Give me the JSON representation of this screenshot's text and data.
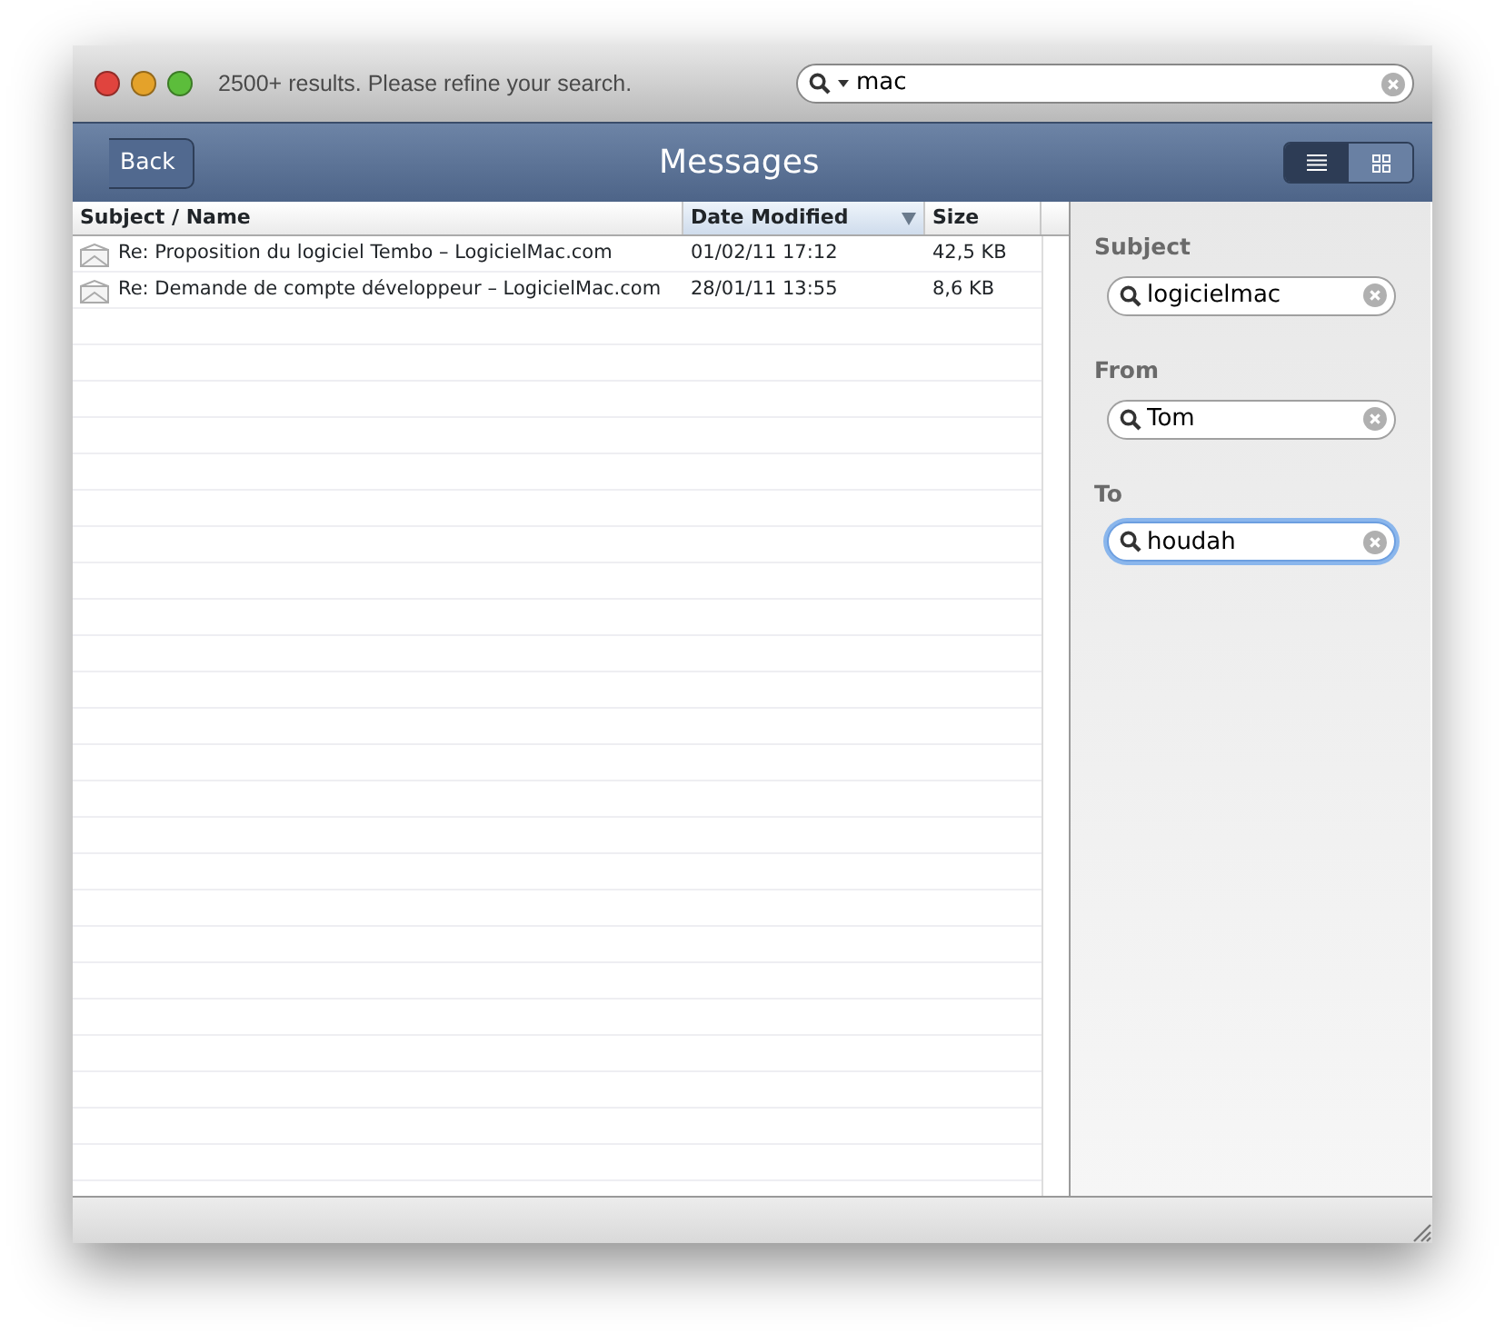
{
  "window": {
    "status_text": "2500+ results. Please refine your search.",
    "search": {
      "value": "mac"
    }
  },
  "toolbar": {
    "back": "Back",
    "title": "Messages",
    "view_modes": [
      {
        "kind": "list",
        "selected": true
      },
      {
        "kind": "grid",
        "selected": false
      }
    ]
  },
  "table": {
    "columns": [
      {
        "label": "Subject / Name",
        "sorted": false
      },
      {
        "label": "Date Modified",
        "sorted": true
      },
      {
        "label": "Size",
        "sorted": false
      }
    ],
    "rows": [
      {
        "cells": [
          "Re: Proposition du logiciel Tembo – LogicielMac.com",
          "01/02/11 17:12",
          "42,5 KB"
        ]
      },
      {
        "cells": [
          "Re: Demande de compte développeur – LogicielMac.com",
          "28/01/11 13:55",
          "8,6 KB"
        ]
      }
    ]
  },
  "filters": [
    {
      "label": "Subject",
      "value": "logicielmac",
      "focused": false
    },
    {
      "label": "From",
      "value": "Tom",
      "focused": false
    },
    {
      "label": "To",
      "value": "houdah",
      "focused": true
    }
  ]
}
